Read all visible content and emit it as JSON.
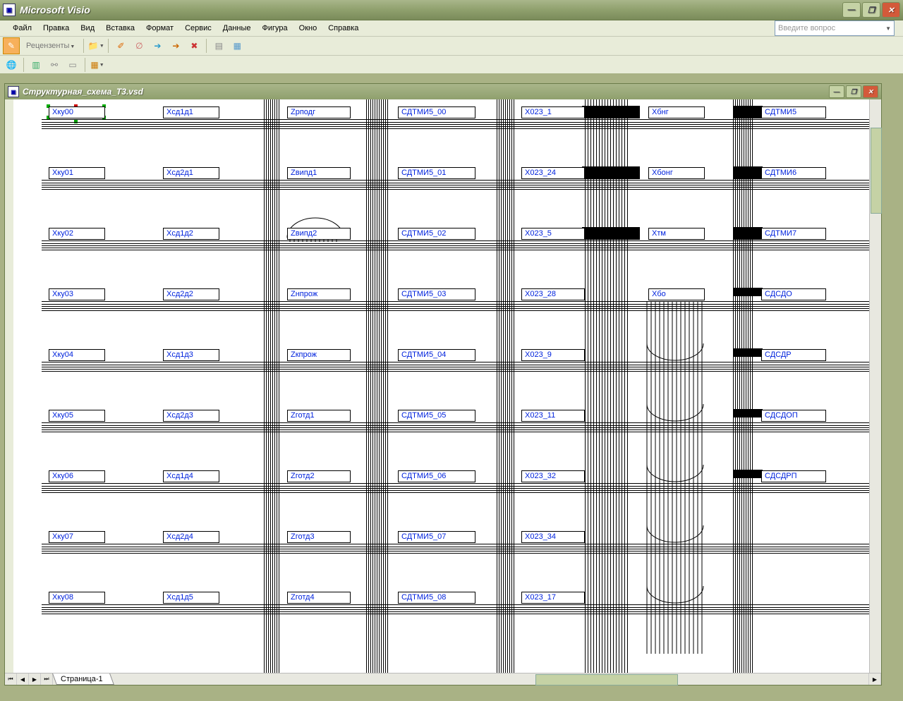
{
  "app_title": "Microsoft Visio",
  "menu": [
    "Файл",
    "Правка",
    "Вид",
    "Вставка",
    "Формат",
    "Сервис",
    "Данные",
    "Фигура",
    "Окно",
    "Справка"
  ],
  "help_placeholder": "Введите вопрос",
  "toolbar1_reviewers": "Рецензенты",
  "doc_title": "Структурная_схема_Т3.vsd",
  "page_tab": "Страница-1",
  "columns": [
    [
      "Хку00",
      "Хку01",
      "Хку02",
      "Хку03",
      "Хку04",
      "Хку05",
      "Хку06",
      "Хку07",
      "Хку08"
    ],
    [
      "Хсд1д1",
      "Хсд2д1",
      "Хсд1д2",
      "Хсд2д2",
      "Хсд1д3",
      "Хсд2д3",
      "Хсд1д4",
      "Хсд2д4",
      "Хсд1д5"
    ],
    [
      "Zрподг",
      "Zвипд1",
      "Zвипд2",
      "Zнпрож",
      "Zкпрож",
      "Zготд1",
      "Zготд2",
      "Zготд3",
      "Zготд4"
    ],
    [
      "СДТМИ5_00",
      "СДТМИ5_01",
      "СДТМИ5_02",
      "СДТМИ5_03",
      "СДТМИ5_04",
      "СДТМИ5_05",
      "СДТМИ5_06",
      "СДТМИ5_07",
      "СДТМИ5_08"
    ],
    [
      "Х023_1",
      "Х023_24",
      "Х023_5",
      "Х023_28",
      "Х023_9",
      "Х023_11",
      "Х023_32",
      "Х023_34",
      "Х023_17"
    ],
    [
      "Хбнг",
      "Хбонг",
      "Хтм",
      "Хбо",
      "",
      "",
      "",
      "",
      ""
    ],
    [
      "СДТМИ5",
      "СДТМИ6",
      "СДТМИ7",
      "СДСДО",
      "СДСДР",
      "СДСДОП",
      "СДСДРП",
      "",
      ""
    ]
  ]
}
